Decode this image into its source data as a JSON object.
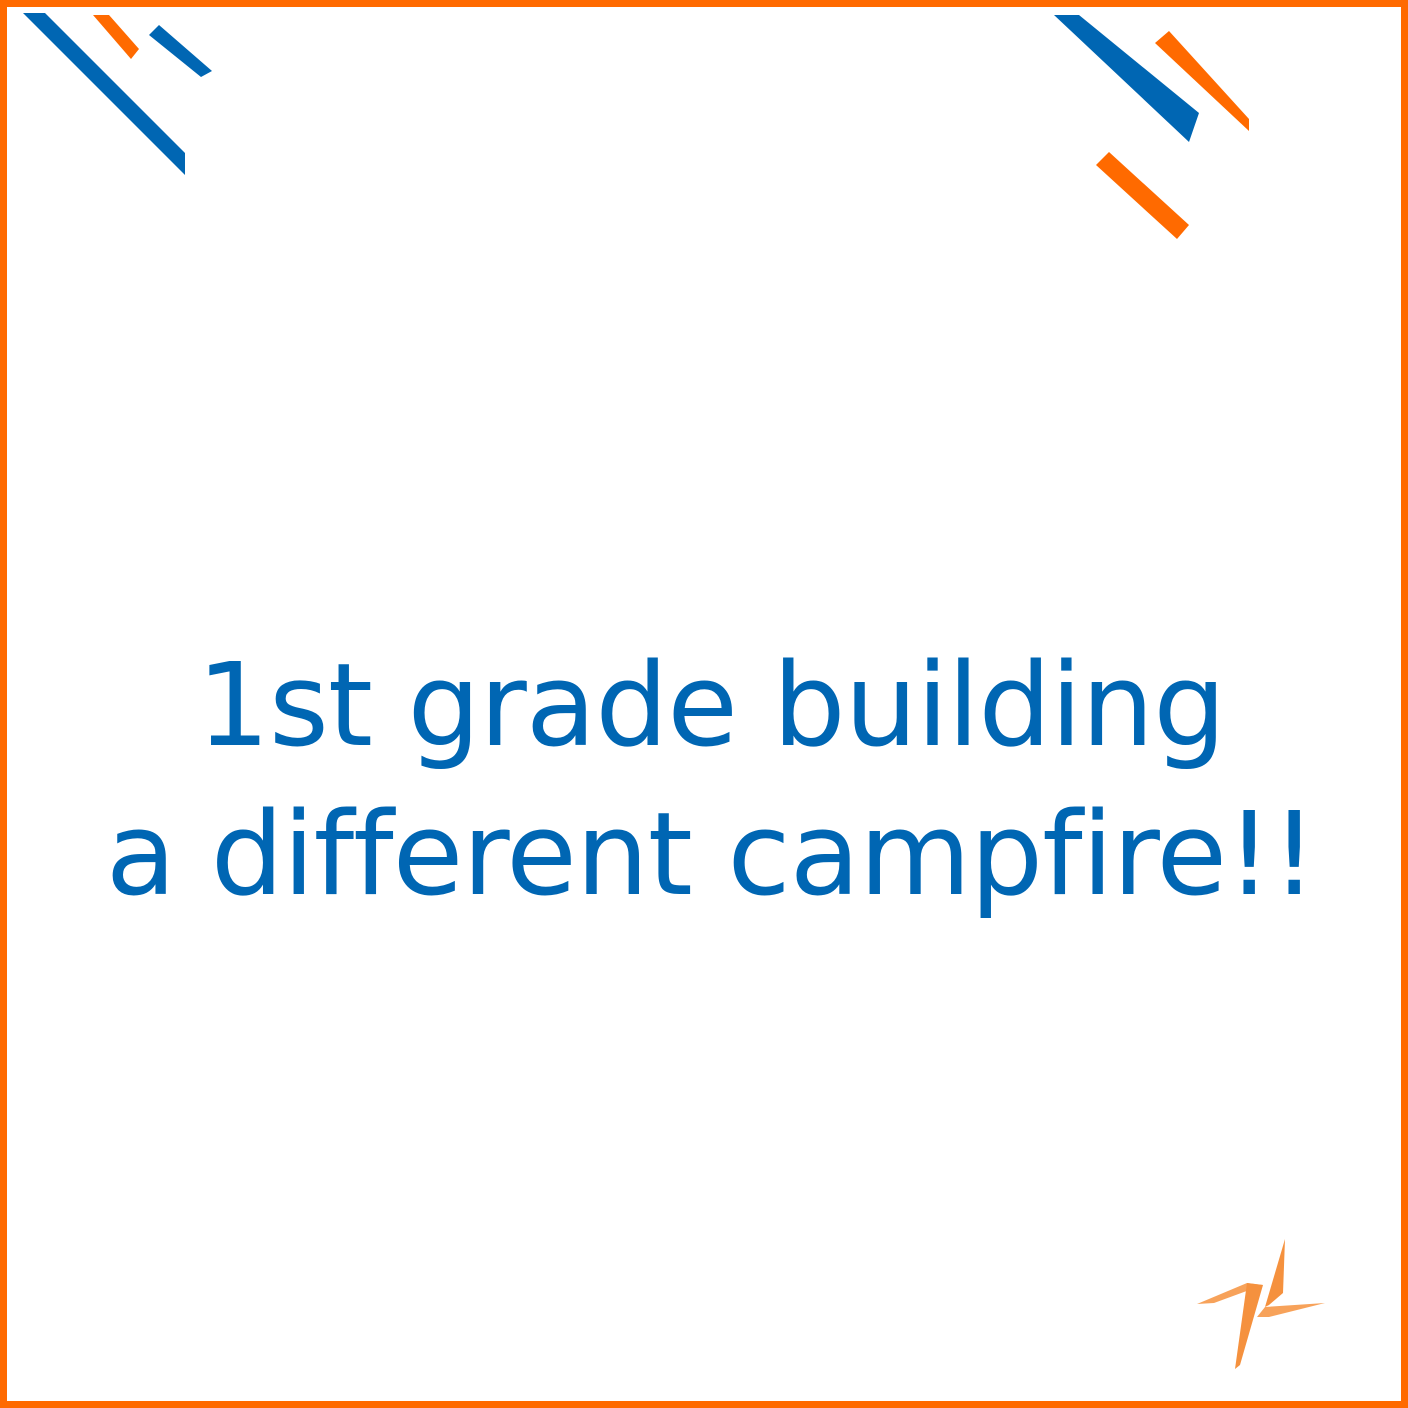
{
  "message": {
    "line1": "1st grade building",
    "line2": "a different campfire!!"
  },
  "colors": {
    "frame": "#ff6a00",
    "accent_blue": "#0066b3",
    "accent_orange": "#ff6a00",
    "logo_orange": "#f5913e",
    "background": "#ffffff"
  },
  "icons": {
    "logo": "orange-bolt-logo-icon"
  }
}
